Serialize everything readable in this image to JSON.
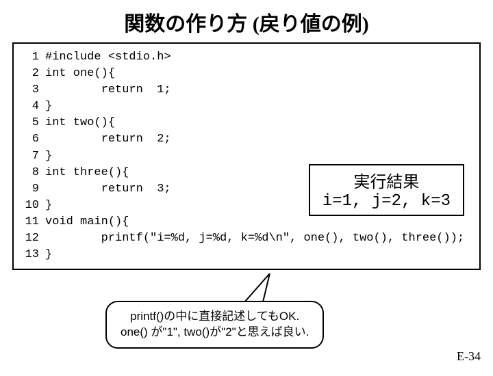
{
  "title": "関数の作り方 (戻り値の例)",
  "code": {
    "lines": [
      {
        "n": "1",
        "t": "#include <stdio.h>"
      },
      {
        "n": "2",
        "t": "int one(){"
      },
      {
        "n": "3",
        "t": "        return  1;"
      },
      {
        "n": "4",
        "t": "}"
      },
      {
        "n": "5",
        "t": "int two(){"
      },
      {
        "n": "6",
        "t": "        return  2;"
      },
      {
        "n": "7",
        "t": "}"
      },
      {
        "n": "8",
        "t": "int three(){"
      },
      {
        "n": "9",
        "t": "        return  3;"
      },
      {
        "n": "10",
        "t": "}"
      },
      {
        "n": "11",
        "t": "void main(){"
      },
      {
        "n": "12",
        "t": "        printf(\"i=%d, j=%d, k=%d\\n\", one(), two(), three());"
      },
      {
        "n": "13",
        "t": "}"
      }
    ]
  },
  "result": {
    "title": "実行結果",
    "text": "i=1, j=2, k=3"
  },
  "callout": {
    "line1": "printf()の中に直接記述してもOK.",
    "line2": "one() が\"1\", two()が\"2\"と思えば良い."
  },
  "page_num": "E-34"
}
